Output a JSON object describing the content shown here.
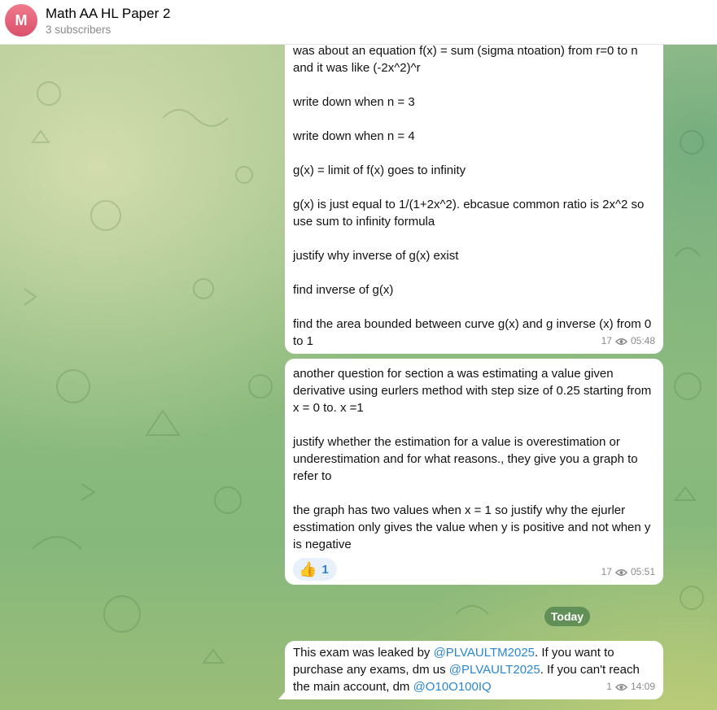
{
  "channel": {
    "avatar_letter": "M",
    "title": "Math AA HL Paper 2",
    "subtitle": "3 subscribers"
  },
  "messages": [
    {
      "paragraphs": [
        "was about an equation f(x) = sum (sigma ntoation) from r=0 to n and it was like (-2x^2)^r",
        "write down when n = 3",
        "write down when n = 4",
        "g(x) = limit of f(x) goes to infinity",
        "g(x) is just equal to 1/(1+2x^2). ebcasue common ratio is 2x^2 so use sum to infinity formula",
        "justify why inverse of g(x) exist",
        "find inverse of g(x)",
        "find the area bounded between curve g(x) and g inverse (x) from 0 to 1"
      ],
      "views": "17",
      "time": "05:48"
    },
    {
      "paragraphs": [
        "another question for section a was estimating a value given derivative using eurlers method with step size of 0.25 starting from x = 0 to. x =1",
        "justify whether the estimation for a value is overestimation or underestimation and for what reasons., they give you a graph to refer to",
        "the graph has two values when x = 1 so justify why the ejurler esstimation only gives the value when y is positive and not when y is negative"
      ],
      "reaction": {
        "emoji": "👍",
        "count": "1"
      },
      "views": "17",
      "time": "05:51"
    },
    {
      "parts": {
        "t1": "This exam was leaked by ",
        "m1": "@PLVAULTM2025",
        "t2": ". If you want to purchase any exams, dm us ",
        "m2": "@PLVAULT2025",
        "t3": ". If you can't reach the main account, dm ",
        "m3": "@O10O100IQ"
      },
      "views": "1",
      "time": "14:09"
    }
  ],
  "date_separator": "Today",
  "colors": {
    "accent": "#2a86d0",
    "bubble": "#ffffff",
    "date_pill": "#4a7d4a"
  }
}
